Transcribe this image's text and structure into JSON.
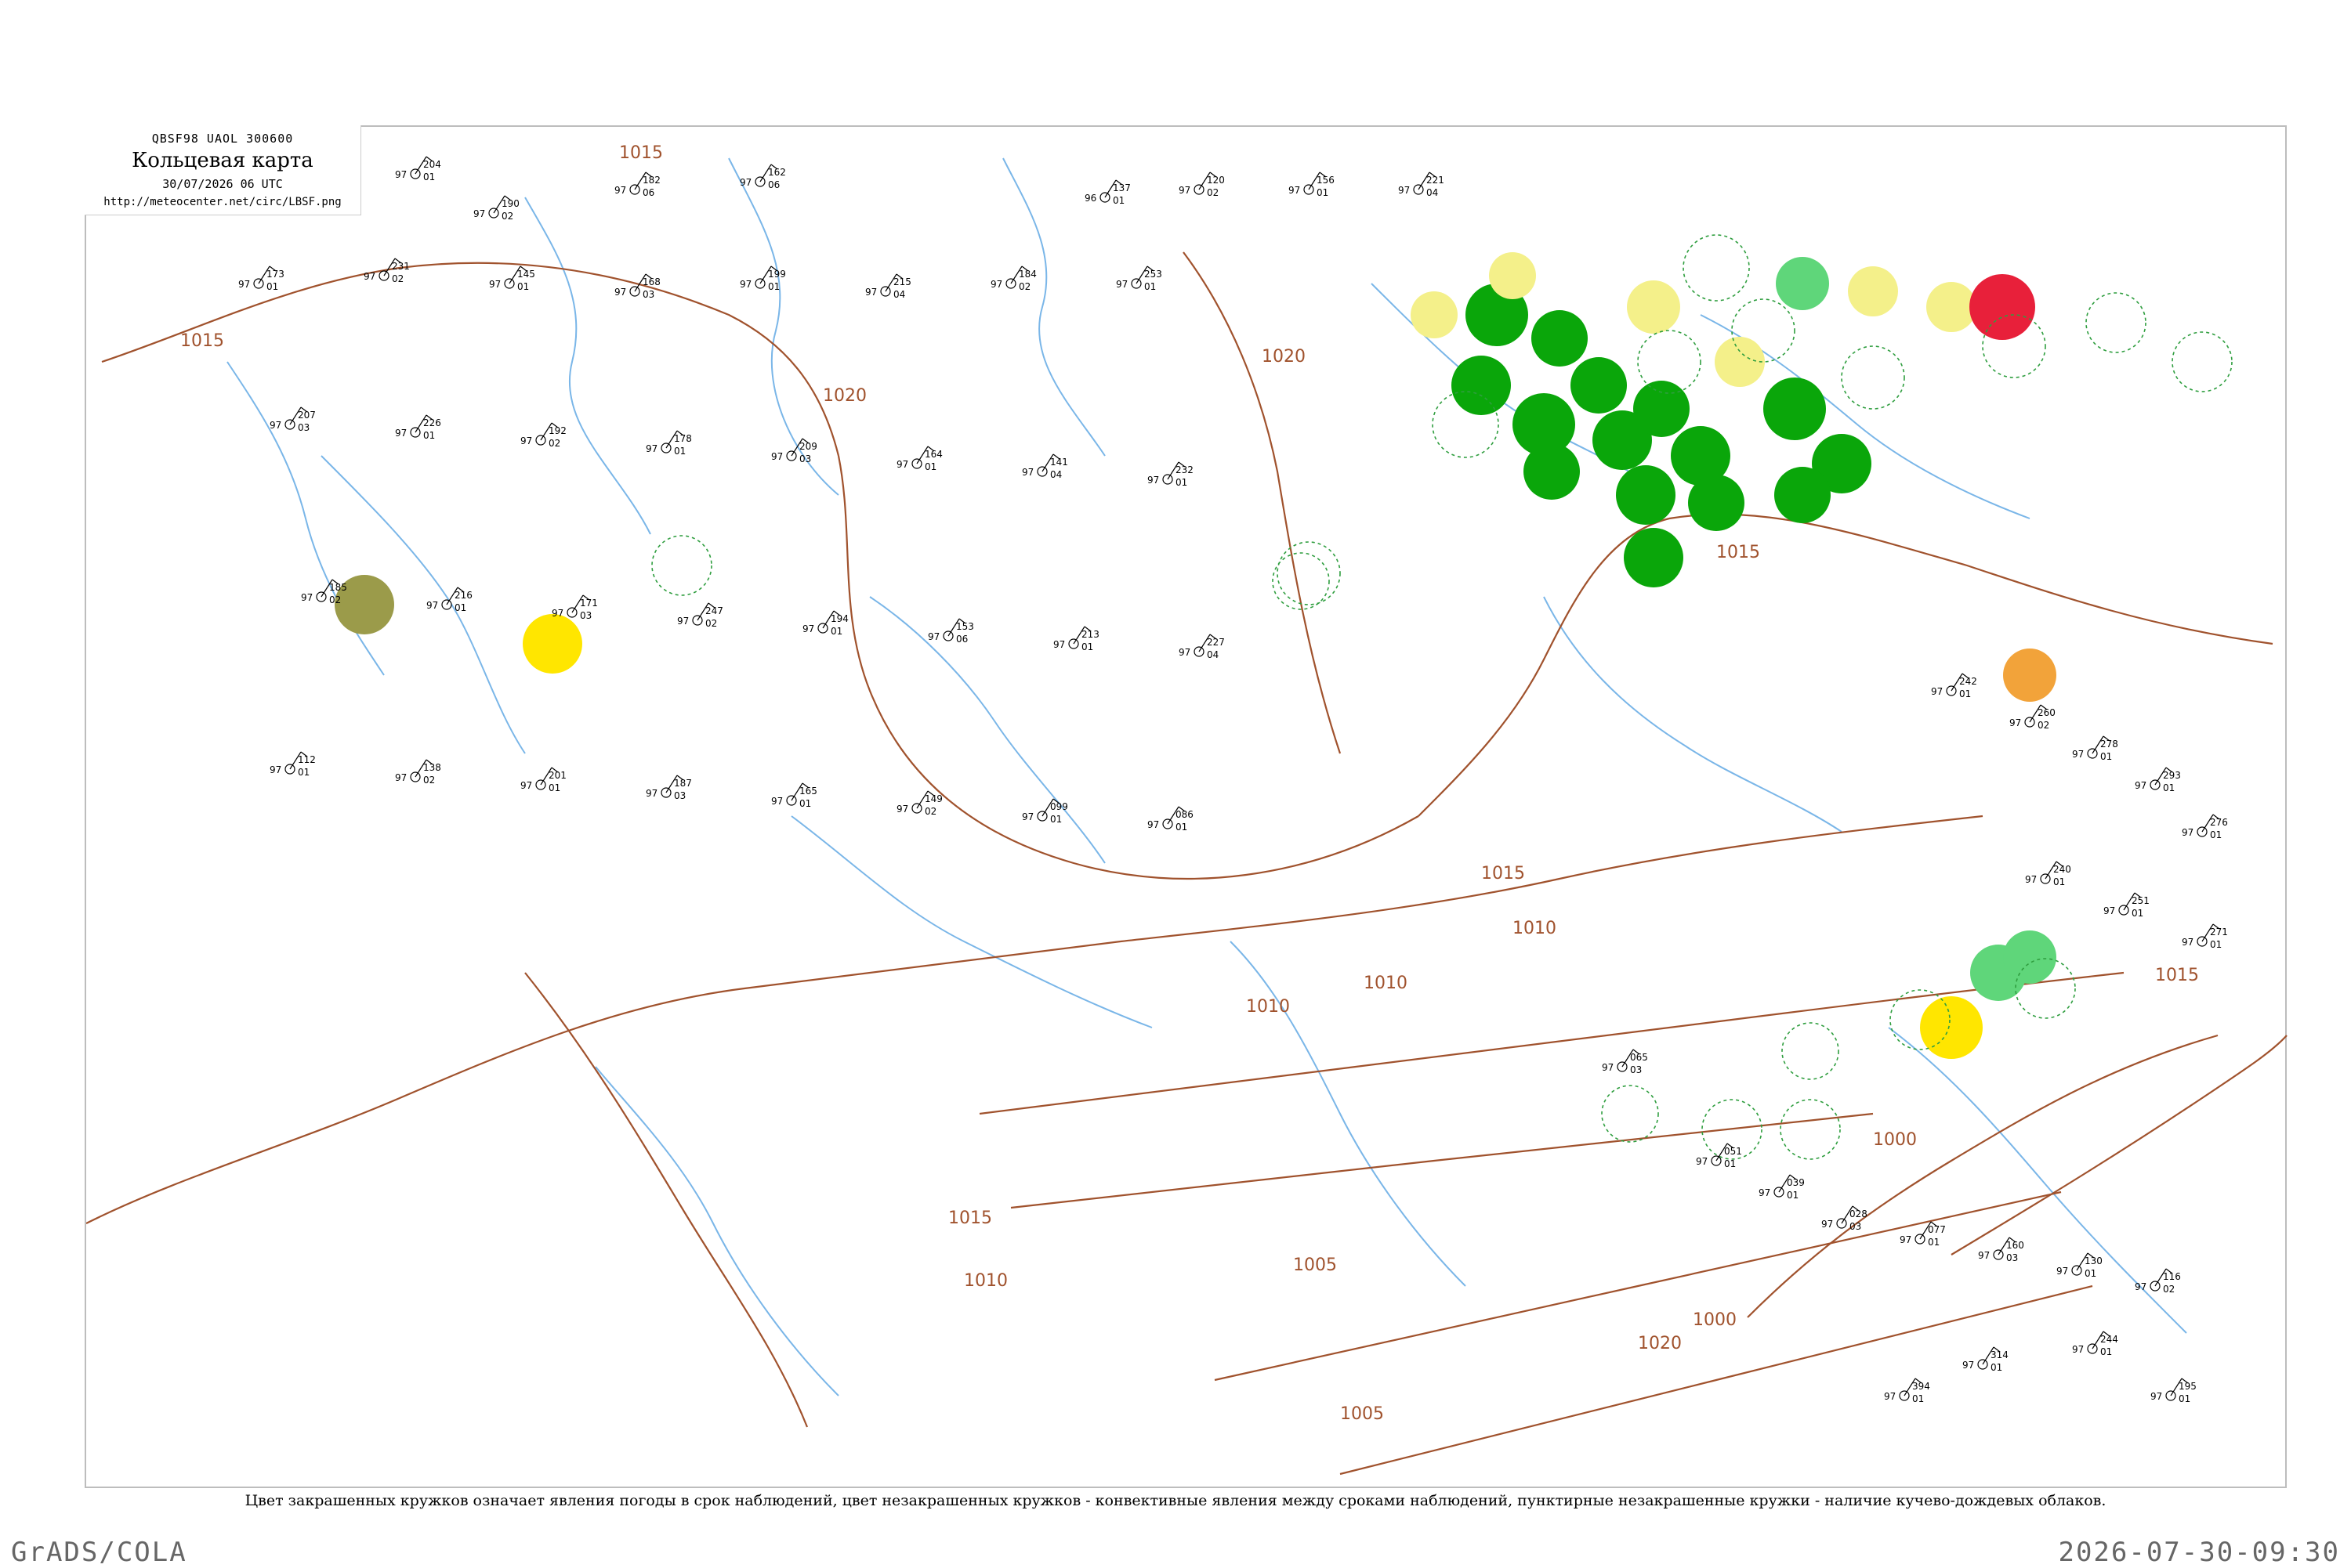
{
  "header": {
    "code": "QBSF98  UAOL  300600",
    "title": "Кольцевая карта",
    "date": "30/07/2026 06 UTC",
    "url": "http://meteocenter.net/circ/LBSF.png"
  },
  "caption": "Цвет закрашенных кружков означает явления погоды в срок наблюдений, цвет незакрашенных кружков - конвективные явления между сроками наблюдений, пунктирные незакрашенные кружки - наличие кучево-дождевых облаков.",
  "footer": {
    "left": "GrADS/COLA",
    "right": "2026-07-30-09:30"
  },
  "colors": {
    "isobar": "#a0522d",
    "river": "#7ab6e8",
    "rain_heavy": "#0aa60a",
    "rain_light": "#5fd67a",
    "drizzle": "#f4f08a",
    "fog": "#ffe600",
    "thunder": "#e8203a",
    "haze": "#9b9b4a",
    "dust": "#f2a33a"
  },
  "isobars": [
    {
      "label": "1015"
    },
    {
      "label": "1015"
    },
    {
      "label": "1020"
    },
    {
      "label": "1020"
    },
    {
      "label": "1015"
    },
    {
      "label": "1020"
    },
    {
      "label": "1015"
    },
    {
      "label": "1010"
    },
    {
      "label": "1015"
    },
    {
      "label": "1010"
    },
    {
      "label": "1010"
    },
    {
      "label": "1005"
    },
    {
      "label": "1000"
    },
    {
      "label": "1000"
    },
    {
      "label": "1005"
    },
    {
      "label": "1010"
    },
    {
      "label": "1015"
    }
  ],
  "stations": [
    {
      "id": "s1",
      "p": "204",
      "t": "97",
      "d": "01"
    },
    {
      "id": "s2",
      "p": "190",
      "t": "97",
      "d": "02"
    },
    {
      "id": "s3",
      "p": "182",
      "t": "97",
      "d": "06"
    },
    {
      "id": "s4",
      "p": "162",
      "t": "97",
      "d": "06"
    },
    {
      "id": "s5",
      "p": "137",
      "t": "96",
      "d": "01"
    },
    {
      "id": "s6",
      "p": "120",
      "t": "97",
      "d": "02"
    },
    {
      "id": "s7",
      "p": "156",
      "t": "97",
      "d": "01"
    },
    {
      "id": "s8",
      "p": "221",
      "t": "97",
      "d": "04"
    },
    {
      "id": "s9",
      "p": "173",
      "t": "97",
      "d": "01"
    },
    {
      "id": "s10",
      "p": "231",
      "t": "97",
      "d": "02"
    },
    {
      "id": "s11",
      "p": "145",
      "t": "97",
      "d": "01"
    },
    {
      "id": "s12",
      "p": "168",
      "t": "97",
      "d": "03"
    },
    {
      "id": "s13",
      "p": "199",
      "t": "97",
      "d": "01"
    },
    {
      "id": "s14",
      "p": "215",
      "t": "97",
      "d": "04"
    },
    {
      "id": "s15",
      "p": "184",
      "t": "97",
      "d": "02"
    },
    {
      "id": "s16",
      "p": "253",
      "t": "97",
      "d": "01"
    },
    {
      "id": "s17",
      "p": "207",
      "t": "97",
      "d": "03"
    },
    {
      "id": "s18",
      "p": "226",
      "t": "97",
      "d": "01"
    },
    {
      "id": "s19",
      "p": "192",
      "t": "97",
      "d": "02"
    },
    {
      "id": "s20",
      "p": "178",
      "t": "97",
      "d": "01"
    },
    {
      "id": "s21",
      "p": "209",
      "t": "97",
      "d": "03"
    },
    {
      "id": "s22",
      "p": "164",
      "t": "97",
      "d": "01"
    },
    {
      "id": "s23",
      "p": "141",
      "t": "97",
      "d": "04"
    },
    {
      "id": "s24",
      "p": "232",
      "t": "97",
      "d": "01"
    },
    {
      "id": "s25",
      "p": "185",
      "t": "97",
      "d": "02"
    },
    {
      "id": "s26",
      "p": "216",
      "t": "97",
      "d": "01"
    },
    {
      "id": "s27",
      "p": "171",
      "t": "97",
      "d": "03"
    },
    {
      "id": "s28",
      "p": "247",
      "t": "97",
      "d": "02"
    },
    {
      "id": "s29",
      "p": "194",
      "t": "97",
      "d": "01"
    },
    {
      "id": "s30",
      "p": "153",
      "t": "97",
      "d": "06"
    },
    {
      "id": "s31",
      "p": "213",
      "t": "97",
      "d": "01"
    },
    {
      "id": "s32",
      "p": "227",
      "t": "97",
      "d": "04"
    },
    {
      "id": "s33",
      "p": "112",
      "t": "97",
      "d": "01"
    },
    {
      "id": "s34",
      "p": "138",
      "t": "97",
      "d": "02"
    },
    {
      "id": "s35",
      "p": "201",
      "t": "97",
      "d": "01"
    },
    {
      "id": "s36",
      "p": "187",
      "t": "97",
      "d": "03"
    },
    {
      "id": "s37",
      "p": "165",
      "t": "97",
      "d": "01"
    },
    {
      "id": "s38",
      "p": "149",
      "t": "97",
      "d": "02"
    },
    {
      "id": "s39",
      "p": "099",
      "t": "97",
      "d": "01"
    },
    {
      "id": "s40",
      "p": "086",
      "t": "97",
      "d": "01"
    },
    {
      "id": "s41",
      "p": "065",
      "t": "97",
      "d": "03"
    },
    {
      "id": "s42",
      "p": "051",
      "t": "97",
      "d": "01"
    },
    {
      "id": "s43",
      "p": "039",
      "t": "97",
      "d": "01"
    },
    {
      "id": "s44",
      "p": "028",
      "t": "97",
      "d": "03"
    },
    {
      "id": "s45",
      "p": "077",
      "t": "97",
      "d": "01"
    },
    {
      "id": "s46",
      "p": "160",
      "t": "97",
      "d": "03"
    },
    {
      "id": "s47",
      "p": "130",
      "t": "97",
      "d": "01"
    },
    {
      "id": "s48",
      "p": "116",
      "t": "97",
      "d": "02"
    },
    {
      "id": "s49",
      "p": "242",
      "t": "97",
      "d": "01"
    },
    {
      "id": "s50",
      "p": "260",
      "t": "97",
      "d": "02"
    },
    {
      "id": "s51",
      "p": "278",
      "t": "97",
      "d": "01"
    },
    {
      "id": "s52",
      "p": "293",
      "t": "97",
      "d": "01"
    },
    {
      "id": "s53",
      "p": "276",
      "t": "97",
      "d": "01"
    },
    {
      "id": "s54",
      "p": "240",
      "t": "97",
      "d": "01"
    },
    {
      "id": "s55",
      "p": "251",
      "t": "97",
      "d": "01"
    },
    {
      "id": "s56",
      "p": "271",
      "t": "97",
      "d": "01"
    },
    {
      "id": "s57",
      "p": "244",
      "t": "97",
      "d": "01"
    },
    {
      "id": "s58",
      "p": "195",
      "t": "97",
      "d": "01"
    },
    {
      "id": "s59",
      "p": "314",
      "t": "97",
      "d": "01"
    },
    {
      "id": "s60",
      "p": "394",
      "t": "97",
      "d": "01"
    }
  ]
}
